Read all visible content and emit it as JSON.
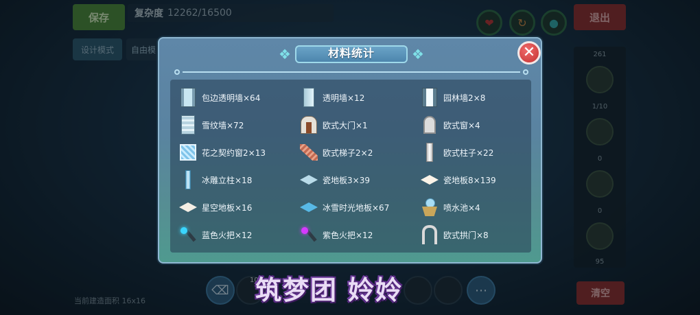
{
  "hud": {
    "save": "保存",
    "complexity_label": "复杂度",
    "complexity_value": "12262/16500",
    "design_mode": "设计模式",
    "free_mode": "自由模",
    "exit": "退出",
    "clear": "清空",
    "build_area": "当前建造面积 16x16",
    "tool_counter": "10",
    "panel_top_count": "261",
    "panel_page": "1/10",
    "panel_zero_a": "0",
    "panel_zero_b": "0",
    "panel_bottom_count": "95"
  },
  "dialog": {
    "title": "材料统计",
    "items": [
      "包边透明墙×64",
      "透明墙×12",
      "园林墙2×8",
      "雪纹墙×72",
      "欧式大门×1",
      "欧式窗×4",
      "花之契约窗2×13",
      "欧式梯子2×2",
      "欧式柱子×22",
      "冰雕立柱×18",
      "瓷地板3×39",
      "瓷地板8×139",
      "星空地板×16",
      "冰雪时光地板×67",
      "喷水池×4",
      "蓝色火把×12",
      "紫色火把×12",
      "欧式拱门×8"
    ]
  },
  "watermark": "筑梦团 姈姈",
  "colors": {
    "dialog_top": "#5f87a8",
    "dialog_bottom": "#4f9a8f",
    "close_button": "#d63c3c",
    "title_accent": "#9fd9ea"
  }
}
